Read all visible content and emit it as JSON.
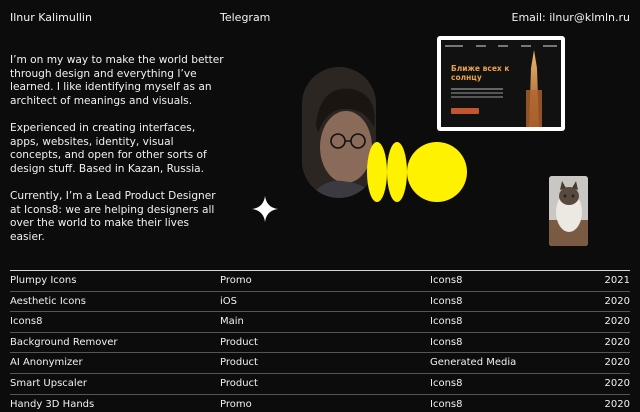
{
  "header": {
    "name": "Ilnur Kalimullin",
    "telegram": "Telegram",
    "email_label": "Email:",
    "email": "ilnur@klmln.ru"
  },
  "bio": {
    "p1": "I’m on my way to make the world better through design and everything I’ve learned. I like identifying myself as an architect of meanings and visuals.",
    "p2": "Experienced in creating interfaces, apps, websites, identity, visual concepts, and open for other sorts of design stuff. Based in Kazan, Russia.",
    "p3": "Currently, I’m a Lead Product Designer at Icons8: we are helping designers all over the world to make their lives easier."
  },
  "preview": {
    "headline": "Ближе всех к солнцу"
  },
  "colors": {
    "accent_yellow": "#fff200",
    "background": "#0c0c0c",
    "preview_headline": "#e8a24a"
  },
  "projects": [
    {
      "name": "Plumpy Icons",
      "type": "Promo",
      "client": "Icons8",
      "year": "2021"
    },
    {
      "name": "Aesthetic Icons",
      "type": "iOS",
      "client": "Icons8",
      "year": "2020"
    },
    {
      "name": "Icons8",
      "type": "Main",
      "client": "Icons8",
      "year": "2020"
    },
    {
      "name": "Background Remover",
      "type": "Product",
      "client": "Icons8",
      "year": "2020"
    },
    {
      "name": "AI Anonymizer",
      "type": "Product",
      "client": "Generated Media",
      "year": "2020"
    },
    {
      "name": "Smart Upscaler",
      "type": "Product",
      "client": "Icons8",
      "year": "2020"
    },
    {
      "name": "Handy 3D Hands",
      "type": "Promo",
      "client": "Icons8",
      "year": "2020"
    }
  ]
}
